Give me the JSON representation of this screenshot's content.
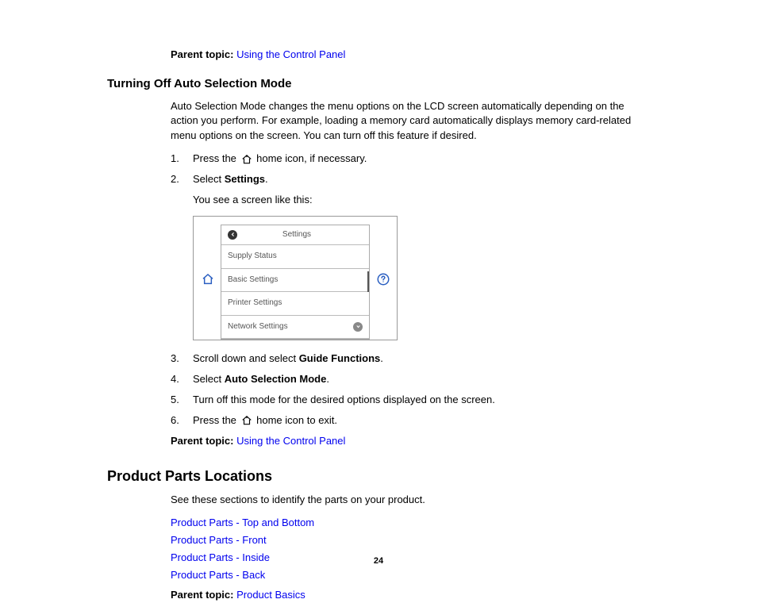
{
  "parent_topic_label": "Parent topic:",
  "parent_topic_1": "Using the Control Panel",
  "section1": {
    "heading": "Turning Off Auto Selection Mode",
    "intro": "Auto Selection Mode changes the menu options on the LCD screen automatically depending on the action you perform. For example, loading a memory card automatically displays memory card-related menu options on the screen. You can turn off this feature if desired.",
    "step1_prefix": "Press the ",
    "step1_suffix": " home icon, if necessary.",
    "step2_prefix": "Select ",
    "step2_bold": "Settings",
    "step2_suffix": ".",
    "step2_note": "You see a screen like this:",
    "step3_prefix": "Scroll down and select ",
    "step3_bold": "Guide Functions",
    "step3_suffix": ".",
    "step4_prefix": "Select ",
    "step4_bold": "Auto Selection Mode",
    "step4_suffix": ".",
    "step5": "Turn off this mode for the desired options displayed on the screen.",
    "step6_prefix": "Press the ",
    "step6_suffix": " home icon to exit.",
    "parent_link": "Using the Control Panel"
  },
  "screenshot": {
    "title": "Settings",
    "rows": [
      "Supply Status",
      "Basic Settings",
      "Printer Settings",
      "Network Settings"
    ]
  },
  "section2": {
    "heading": "Product Parts Locations",
    "intro": "See these sections to identify the parts on your product.",
    "links": [
      "Product Parts - Top and Bottom",
      "Product Parts - Front",
      "Product Parts - Inside",
      "Product Parts - Back"
    ],
    "parent_link": "Product Basics"
  },
  "page_number": "24"
}
